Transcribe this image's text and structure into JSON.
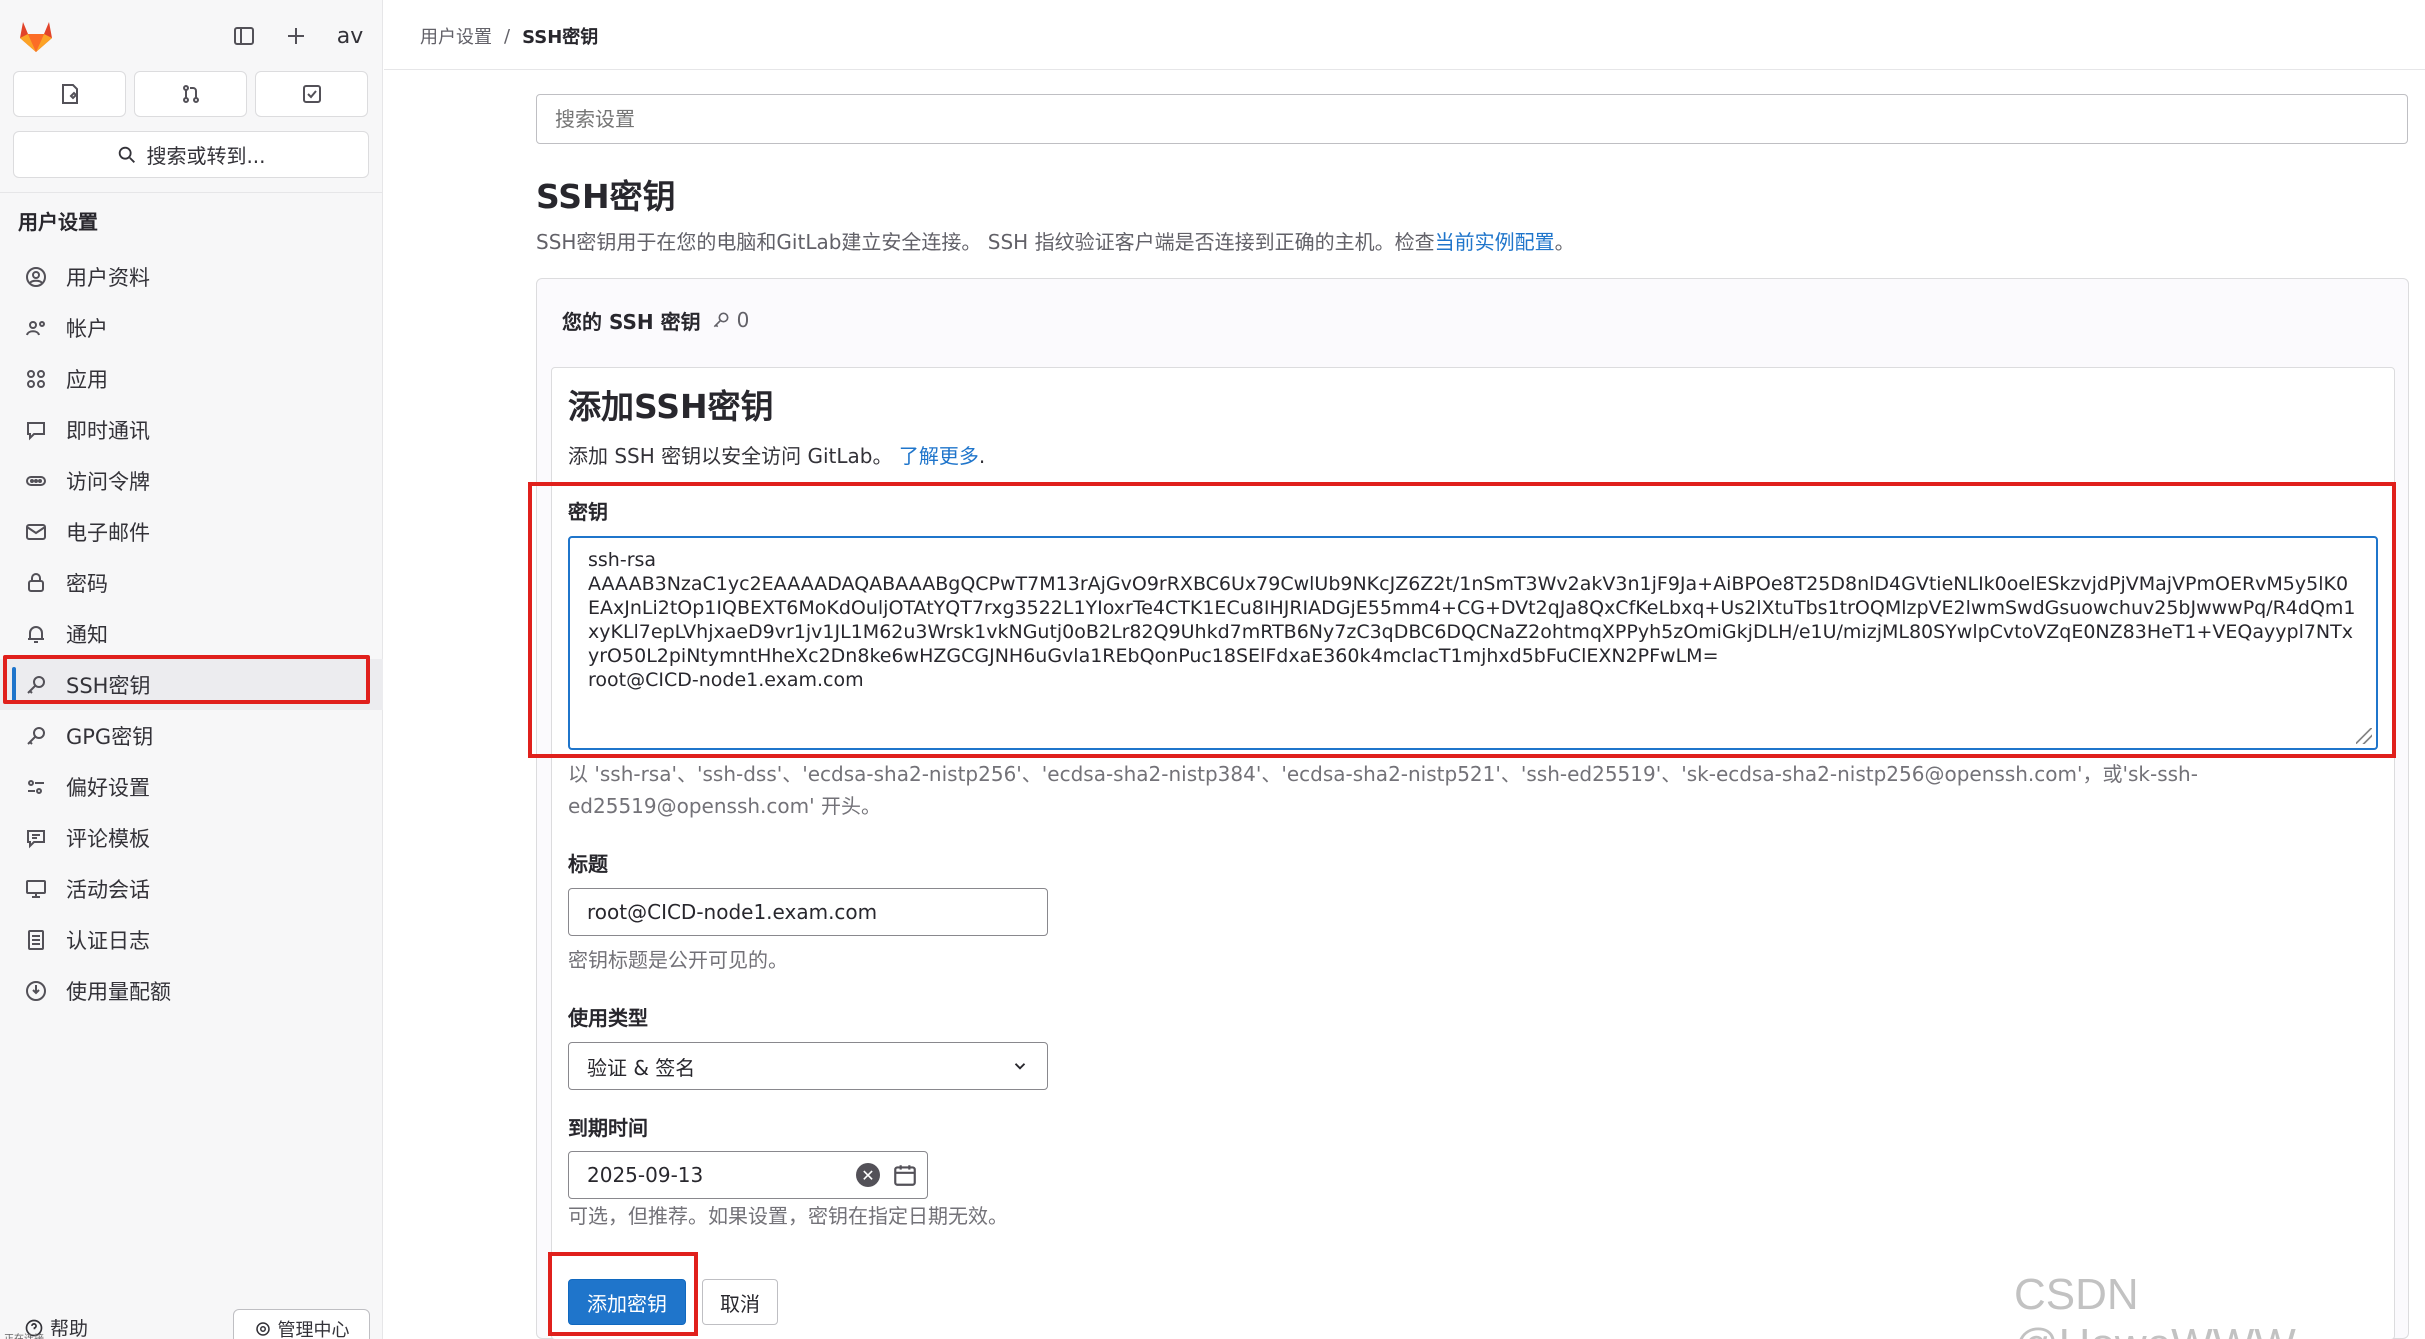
{
  "header": {
    "avatar_text": "av"
  },
  "sidebar": {
    "search_label": "搜索或转到...",
    "section_title": "用户设置",
    "items": [
      {
        "label": "用户资料",
        "icon": "profile-icon"
      },
      {
        "label": "帐户",
        "icon": "account-icon"
      },
      {
        "label": "应用",
        "icon": "applications-icon"
      },
      {
        "label": "即时通讯",
        "icon": "chat-icon"
      },
      {
        "label": "访问令牌",
        "icon": "token-icon"
      },
      {
        "label": "电子邮件",
        "icon": "mail-icon"
      },
      {
        "label": "密码",
        "icon": "lock-icon"
      },
      {
        "label": "通知",
        "icon": "bell-icon"
      },
      {
        "label": "SSH密钥",
        "icon": "key-icon",
        "active": true
      },
      {
        "label": "GPG密钥",
        "icon": "key-icon"
      },
      {
        "label": "偏好设置",
        "icon": "preferences-icon"
      },
      {
        "label": "评论模板",
        "icon": "comment-icon"
      },
      {
        "label": "活动会话",
        "icon": "monitor-icon"
      },
      {
        "label": "认证日志",
        "icon": "log-icon"
      },
      {
        "label": "使用量配额",
        "icon": "quota-icon"
      }
    ],
    "help_label": "帮助",
    "admin_label": "管理中心",
    "status_text": "正在连接..."
  },
  "breadcrumb": {
    "parent": "用户设置",
    "separator": "/",
    "current": "SSH密钥"
  },
  "settings_search": {
    "placeholder": "搜索设置"
  },
  "page": {
    "title": "SSH密钥",
    "description": "SSH密钥用于在您的电脑和GitLab建立安全连接。 SSH 指纹验证客户端是否连接到正确的主机。检查",
    "description_link": "当前实例配置",
    "description_end": "。"
  },
  "keys_card": {
    "title": "您的 SSH 密钥",
    "count": "0"
  },
  "add_form": {
    "title": "添加SSH密钥",
    "description": "添加 SSH 密钥以安全访问 GitLab。",
    "learn_more": "了解更多",
    "learn_more_end": ".",
    "key_label": "密钥",
    "key_value": "ssh-rsa\nAAAAB3NzaC1yc2EAAAADAQABAAABgQCPwT7M13rAjGvO9rRXBC6Ux79CwlUb9NKcJZ6Z2t/1nSmT3Wv2akV3n1jF9Ja+AiBPOe8T25D8nlD4GVtieNLIk0oelESkzvjdPjVMajVPmOERvM5y5lK0EAxJnLi2tOp1IQBEXT6MoKdOuljOTAtYQT7rxg3522L1YIoxrTe4CTK1ECu8IHJRIADGjE55mm4+CG+DVt2qJa8QxCfKeLbxq+Us2lXtuTbs1trOQMlzpVE2lwmSwdGsuowchuv25bJwwwPq/R4dQm1xyKLl7epLVhjxaeD9vr1jv1JL1M62u3Wrsk1vkNGutj0oB2Lr82Q9Uhkd7mRTB6Ny7zC3qDBC6DQCNaZ2ohtmqXPPyh5zOmiGkjDLH/e1U/mizjML80SYwlpCvtoVZqE0NZ83HeT1+VEQayypl7NTxyrO50L2piNtymntHheXc2Dn8ke6wHZGCGJNH6uGvla1REbQonPuc18SElFdxaE360k4mclacT1mjhxd5bFuClEXN2PFwLM=\nroot@CICD-node1.exam.com",
    "key_help": "以 'ssh-rsa'、'ssh-dss'、'ecdsa-sha2-nistp256'、'ecdsa-sha2-nistp384'、'ecdsa-sha2-nistp521'、'ssh-ed25519'、'sk-ecdsa-sha2-nistp256@openssh.com'，或'sk-ssh-ed25519@openssh.com' 开头。",
    "title_label": "标题",
    "title_value": "root@CICD-node1.exam.com",
    "title_help": "密钥标题是公开可见的。",
    "usage_label": "使用类型",
    "usage_value": "验证 & 签名",
    "expiry_label": "到期时间",
    "expiry_value": "2025-09-13",
    "expiry_help": "可选，但推荐。如果设置，密钥在指定日期无效。",
    "submit_label": "添加密钥",
    "cancel_label": "取消"
  },
  "watermark": "CSDN @HoweWWW",
  "colors": {
    "accent": "#1f75cb",
    "highlight_box": "#e0201c"
  }
}
